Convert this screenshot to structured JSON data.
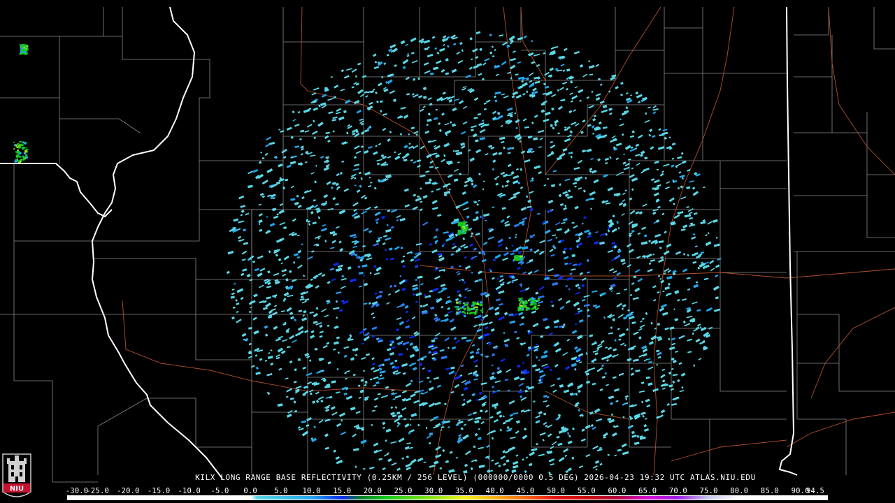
{
  "caption": "KILX LONG RANGE BASE REFLECTIVITY (0.25KM / 256 LEVEL) (000000/0000 0.5 DEG) 2026-04-23 19:32 UTC  ATLAS.NIU.EDU",
  "logo_text": "NIU",
  "scale": {
    "labels": [
      "-30.0",
      "-25.0",
      "-20.0",
      "-15.0",
      "-10.0",
      "-5.0",
      "0.0",
      "5.0",
      "10.0",
      "15.0",
      "20.0",
      "25.0",
      "30.0",
      "35.0",
      "40.0",
      "45.0",
      "50.0",
      "55.0",
      "60.0",
      "65.0",
      "70.0",
      "75.0",
      "80.0",
      "85.0",
      "90.0",
      "94.5"
    ],
    "min": -30.0,
    "max": 94.5,
    "stops": [
      {
        "value": -30,
        "color": "#ffffff"
      },
      {
        "value": 0,
        "color": "#ffffff"
      },
      {
        "value": 1,
        "color": "#5ad7e6"
      },
      {
        "value": 10,
        "color": "#23a6ec"
      },
      {
        "value": 15,
        "color": "#0b2cf0"
      },
      {
        "value": 18,
        "color": "#0a7f2a"
      },
      {
        "value": 22,
        "color": "#15c91b"
      },
      {
        "value": 30,
        "color": "#8fe51c"
      },
      {
        "value": 35,
        "color": "#f3f31a"
      },
      {
        "value": 40,
        "color": "#f7b11c"
      },
      {
        "value": 45,
        "color": "#f56a12"
      },
      {
        "value": 50,
        "color": "#e81414"
      },
      {
        "value": 55,
        "color": "#cc0f10"
      },
      {
        "value": 60,
        "color": "#b3093a"
      },
      {
        "value": 65,
        "color": "#d611d6"
      },
      {
        "value": 70,
        "color": "#a01ee0"
      },
      {
        "value": 75,
        "color": "#c8c8f0"
      },
      {
        "value": 80,
        "color": "#ffffff"
      },
      {
        "value": 94.5,
        "color": "#ffffff"
      }
    ]
  },
  "colors": {
    "background": "#000000",
    "state_border": "#ffffff",
    "county_line": "#8a8a8a",
    "highway": "#b2502a"
  },
  "radar": {
    "site": "KILX",
    "echo_colors": [
      "#5ad7e6",
      "#23a6ec",
      "#2a78f0",
      "#0b2cf0",
      "#15c91b",
      "#8fe51c"
    ]
  }
}
